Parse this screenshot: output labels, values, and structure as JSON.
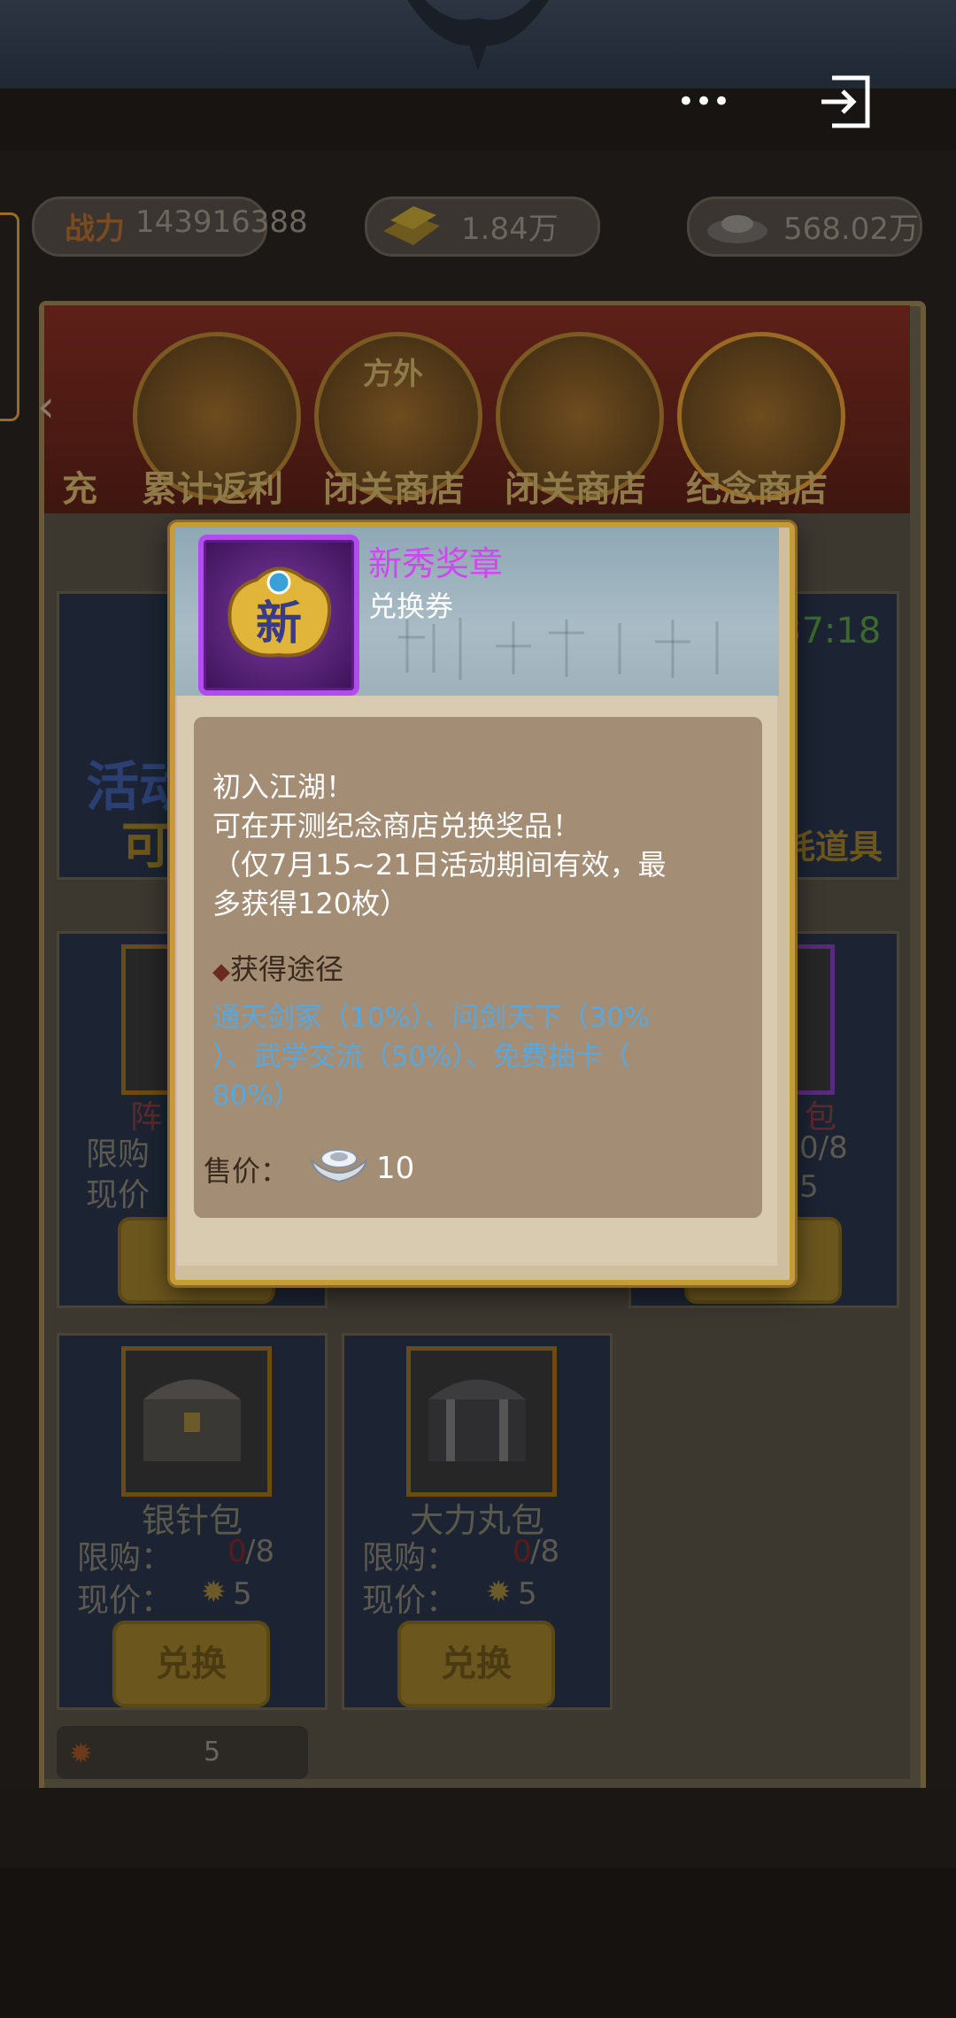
{
  "topbar": {
    "more_icon": "ellipsis-icon",
    "exit_icon": "exit-icon"
  },
  "stats": {
    "power_label": "战力",
    "power_value": "143916388",
    "gold_value": "1.84万",
    "silver_value": "568.02万"
  },
  "shop_tabs": [
    {
      "label": "充"
    },
    {
      "label": "累计返利"
    },
    {
      "label": "闭关商店",
      "sign": "方外"
    },
    {
      "label": "闭关商店"
    },
    {
      "label": "纪念商店"
    }
  ],
  "timer": "37:18",
  "cards": [
    {
      "name": "银针包",
      "limit_label": "限购：",
      "limit_used": "0",
      "limit_total": "/8",
      "price_label": "现价：",
      "price": "5",
      "button": "兑换"
    },
    {
      "name": "大力丸包",
      "limit_label": "限购：",
      "limit_used": "0",
      "limit_total": "/8",
      "price_label": "现价：",
      "price": "5",
      "button": "兑换"
    }
  ],
  "hidden_card_fragments": {
    "a_name": "阵",
    "a_limit": "限购",
    "a_price": "现价",
    "b_name": "包",
    "b_limit": "0/8",
    "b_price": "5",
    "left_banner": "活动",
    "left_banner2": "可",
    "right_banner": "耗道具"
  },
  "currency_value": "5",
  "dialog": {
    "item_name": "新秀奖章",
    "item_type": "兑换券",
    "item_icon_text": "新",
    "description": [
      "初入江湖！",
      "可在开测纪念商店兑换奖品！",
      "（仅7月15~21日活动期间有效，最",
      "多获得120枚）"
    ],
    "source_heading": "获得途径",
    "source_lines": [
      "通天剑冢（10%）、问剑天下（30%",
      "）、武学交流（50%）、免费抽卡（",
      "80%）"
    ],
    "price_label": "售价：",
    "price_value": "10",
    "price_icon": "silver-ingot-icon"
  }
}
